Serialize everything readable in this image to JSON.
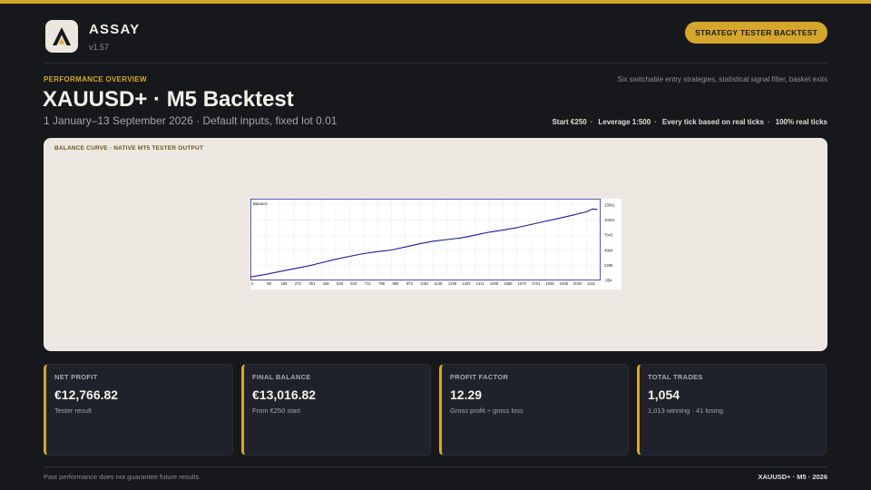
{
  "brand": {
    "name": "ASSAY",
    "version": "v1.57",
    "logo_icon": "assay-a-logo",
    "accent": "#d4a72c"
  },
  "header": {
    "pill_label": "STRATEGY TESTER BACKTEST"
  },
  "overview": {
    "eyebrow": "PERFORMANCE OVERVIEW",
    "tagline": "Six switchable entry strategies, statistical signal filter, basket exits",
    "title": "XAUUSD+ · M5 Backtest",
    "subtitle": "1 January–13 September 2026 · Default inputs, fixed lot 0.01",
    "meta": [
      "Start €250",
      "Leverage 1:500",
      "Every tick based on real ticks",
      "100% real ticks"
    ]
  },
  "chart_card": {
    "title": "BALANCE CURVE · NATIVE MT5 TESTER OUTPUT"
  },
  "chart_data": {
    "type": "line",
    "title": "Balance",
    "x_ticks": [
      "0",
      "98",
      "186",
      "273",
      "361",
      "448",
      "536",
      "623",
      "711",
      "798",
      "886",
      "973",
      "1061",
      "1148",
      "1236",
      "1323",
      "1411",
      "1498",
      "1586",
      "1673",
      "1761",
      "1848",
      "1936",
      "2023",
      "2111"
    ],
    "y_ticks": [
      "-354",
      "2285",
      "4964",
      "7643",
      "10322",
      "13001"
    ],
    "ylim": [
      -354,
      14100
    ],
    "xlim": [
      0,
      2200
    ],
    "grid": true,
    "series": [
      {
        "color": "#1c1c96",
        "points": [
          [
            0,
            250
          ],
          [
            98,
            720
          ],
          [
            186,
            1220
          ],
          [
            273,
            1700
          ],
          [
            361,
            2180
          ],
          [
            448,
            2780
          ],
          [
            536,
            3380
          ],
          [
            623,
            3900
          ],
          [
            711,
            4380
          ],
          [
            798,
            4740
          ],
          [
            886,
            5020
          ],
          [
            973,
            5560
          ],
          [
            1061,
            6120
          ],
          [
            1148,
            6580
          ],
          [
            1236,
            6880
          ],
          [
            1323,
            7160
          ],
          [
            1411,
            7650
          ],
          [
            1498,
            8180
          ],
          [
            1586,
            8540
          ],
          [
            1673,
            8980
          ],
          [
            1761,
            9520
          ],
          [
            1848,
            10080
          ],
          [
            1936,
            10620
          ],
          [
            2023,
            11180
          ],
          [
            2111,
            11780
          ],
          [
            2150,
            12280
          ],
          [
            2180,
            12200
          ]
        ]
      }
    ]
  },
  "stats": [
    {
      "label": "NET PROFIT",
      "value": "€12,766.82",
      "sub": "Tester result"
    },
    {
      "label": "FINAL BALANCE",
      "value": "€13,016.82",
      "sub": "From €250 start"
    },
    {
      "label": "PROFIT FACTOR",
      "value": "12.29",
      "sub": "Gross profit ÷ gross loss"
    },
    {
      "label": "TOTAL TRADES",
      "value": "1,054",
      "sub": "1,013 winning · 41 losing"
    }
  ],
  "footer": {
    "disclaimer": "Past performance does not guarantee future results.",
    "right": "XAUUSD+ · M5 · 2026"
  }
}
